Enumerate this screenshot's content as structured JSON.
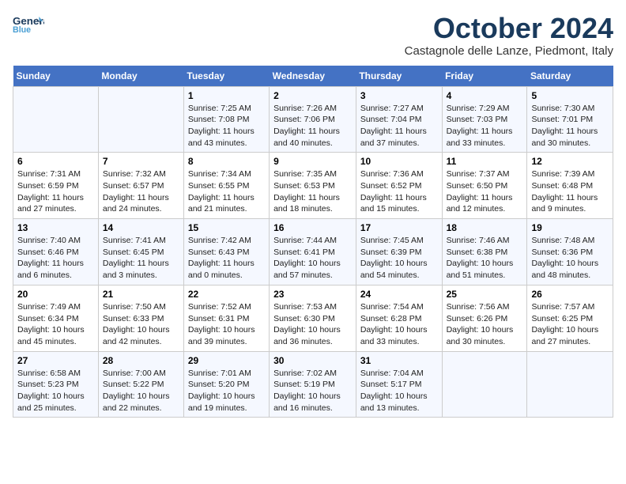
{
  "header": {
    "logo_line1": "General",
    "logo_line2": "Blue",
    "month_title": "October 2024",
    "location": "Castagnole delle Lanze, Piedmont, Italy"
  },
  "weekdays": [
    "Sunday",
    "Monday",
    "Tuesday",
    "Wednesday",
    "Thursday",
    "Friday",
    "Saturday"
  ],
  "weeks": [
    [
      {
        "day": "",
        "sunrise": "",
        "sunset": "",
        "daylight": ""
      },
      {
        "day": "",
        "sunrise": "",
        "sunset": "",
        "daylight": ""
      },
      {
        "day": "1",
        "sunrise": "Sunrise: 7:25 AM",
        "sunset": "Sunset: 7:08 PM",
        "daylight": "Daylight: 11 hours and 43 minutes."
      },
      {
        "day": "2",
        "sunrise": "Sunrise: 7:26 AM",
        "sunset": "Sunset: 7:06 PM",
        "daylight": "Daylight: 11 hours and 40 minutes."
      },
      {
        "day": "3",
        "sunrise": "Sunrise: 7:27 AM",
        "sunset": "Sunset: 7:04 PM",
        "daylight": "Daylight: 11 hours and 37 minutes."
      },
      {
        "day": "4",
        "sunrise": "Sunrise: 7:29 AM",
        "sunset": "Sunset: 7:03 PM",
        "daylight": "Daylight: 11 hours and 33 minutes."
      },
      {
        "day": "5",
        "sunrise": "Sunrise: 7:30 AM",
        "sunset": "Sunset: 7:01 PM",
        "daylight": "Daylight: 11 hours and 30 minutes."
      }
    ],
    [
      {
        "day": "6",
        "sunrise": "Sunrise: 7:31 AM",
        "sunset": "Sunset: 6:59 PM",
        "daylight": "Daylight: 11 hours and 27 minutes."
      },
      {
        "day": "7",
        "sunrise": "Sunrise: 7:32 AM",
        "sunset": "Sunset: 6:57 PM",
        "daylight": "Daylight: 11 hours and 24 minutes."
      },
      {
        "day": "8",
        "sunrise": "Sunrise: 7:34 AM",
        "sunset": "Sunset: 6:55 PM",
        "daylight": "Daylight: 11 hours and 21 minutes."
      },
      {
        "day": "9",
        "sunrise": "Sunrise: 7:35 AM",
        "sunset": "Sunset: 6:53 PM",
        "daylight": "Daylight: 11 hours and 18 minutes."
      },
      {
        "day": "10",
        "sunrise": "Sunrise: 7:36 AM",
        "sunset": "Sunset: 6:52 PM",
        "daylight": "Daylight: 11 hours and 15 minutes."
      },
      {
        "day": "11",
        "sunrise": "Sunrise: 7:37 AM",
        "sunset": "Sunset: 6:50 PM",
        "daylight": "Daylight: 11 hours and 12 minutes."
      },
      {
        "day": "12",
        "sunrise": "Sunrise: 7:39 AM",
        "sunset": "Sunset: 6:48 PM",
        "daylight": "Daylight: 11 hours and 9 minutes."
      }
    ],
    [
      {
        "day": "13",
        "sunrise": "Sunrise: 7:40 AM",
        "sunset": "Sunset: 6:46 PM",
        "daylight": "Daylight: 11 hours and 6 minutes."
      },
      {
        "day": "14",
        "sunrise": "Sunrise: 7:41 AM",
        "sunset": "Sunset: 6:45 PM",
        "daylight": "Daylight: 11 hours and 3 minutes."
      },
      {
        "day": "15",
        "sunrise": "Sunrise: 7:42 AM",
        "sunset": "Sunset: 6:43 PM",
        "daylight": "Daylight: 11 hours and 0 minutes."
      },
      {
        "day": "16",
        "sunrise": "Sunrise: 7:44 AM",
        "sunset": "Sunset: 6:41 PM",
        "daylight": "Daylight: 10 hours and 57 minutes."
      },
      {
        "day": "17",
        "sunrise": "Sunrise: 7:45 AM",
        "sunset": "Sunset: 6:39 PM",
        "daylight": "Daylight: 10 hours and 54 minutes."
      },
      {
        "day": "18",
        "sunrise": "Sunrise: 7:46 AM",
        "sunset": "Sunset: 6:38 PM",
        "daylight": "Daylight: 10 hours and 51 minutes."
      },
      {
        "day": "19",
        "sunrise": "Sunrise: 7:48 AM",
        "sunset": "Sunset: 6:36 PM",
        "daylight": "Daylight: 10 hours and 48 minutes."
      }
    ],
    [
      {
        "day": "20",
        "sunrise": "Sunrise: 7:49 AM",
        "sunset": "Sunset: 6:34 PM",
        "daylight": "Daylight: 10 hours and 45 minutes."
      },
      {
        "day": "21",
        "sunrise": "Sunrise: 7:50 AM",
        "sunset": "Sunset: 6:33 PM",
        "daylight": "Daylight: 10 hours and 42 minutes."
      },
      {
        "day": "22",
        "sunrise": "Sunrise: 7:52 AM",
        "sunset": "Sunset: 6:31 PM",
        "daylight": "Daylight: 10 hours and 39 minutes."
      },
      {
        "day": "23",
        "sunrise": "Sunrise: 7:53 AM",
        "sunset": "Sunset: 6:30 PM",
        "daylight": "Daylight: 10 hours and 36 minutes."
      },
      {
        "day": "24",
        "sunrise": "Sunrise: 7:54 AM",
        "sunset": "Sunset: 6:28 PM",
        "daylight": "Daylight: 10 hours and 33 minutes."
      },
      {
        "day": "25",
        "sunrise": "Sunrise: 7:56 AM",
        "sunset": "Sunset: 6:26 PM",
        "daylight": "Daylight: 10 hours and 30 minutes."
      },
      {
        "day": "26",
        "sunrise": "Sunrise: 7:57 AM",
        "sunset": "Sunset: 6:25 PM",
        "daylight": "Daylight: 10 hours and 27 minutes."
      }
    ],
    [
      {
        "day": "27",
        "sunrise": "Sunrise: 6:58 AM",
        "sunset": "Sunset: 5:23 PM",
        "daylight": "Daylight: 10 hours and 25 minutes."
      },
      {
        "day": "28",
        "sunrise": "Sunrise: 7:00 AM",
        "sunset": "Sunset: 5:22 PM",
        "daylight": "Daylight: 10 hours and 22 minutes."
      },
      {
        "day": "29",
        "sunrise": "Sunrise: 7:01 AM",
        "sunset": "Sunset: 5:20 PM",
        "daylight": "Daylight: 10 hours and 19 minutes."
      },
      {
        "day": "30",
        "sunrise": "Sunrise: 7:02 AM",
        "sunset": "Sunset: 5:19 PM",
        "daylight": "Daylight: 10 hours and 16 minutes."
      },
      {
        "day": "31",
        "sunrise": "Sunrise: 7:04 AM",
        "sunset": "Sunset: 5:17 PM",
        "daylight": "Daylight: 10 hours and 13 minutes."
      },
      {
        "day": "",
        "sunrise": "",
        "sunset": "",
        "daylight": ""
      },
      {
        "day": "",
        "sunrise": "",
        "sunset": "",
        "daylight": ""
      }
    ]
  ]
}
